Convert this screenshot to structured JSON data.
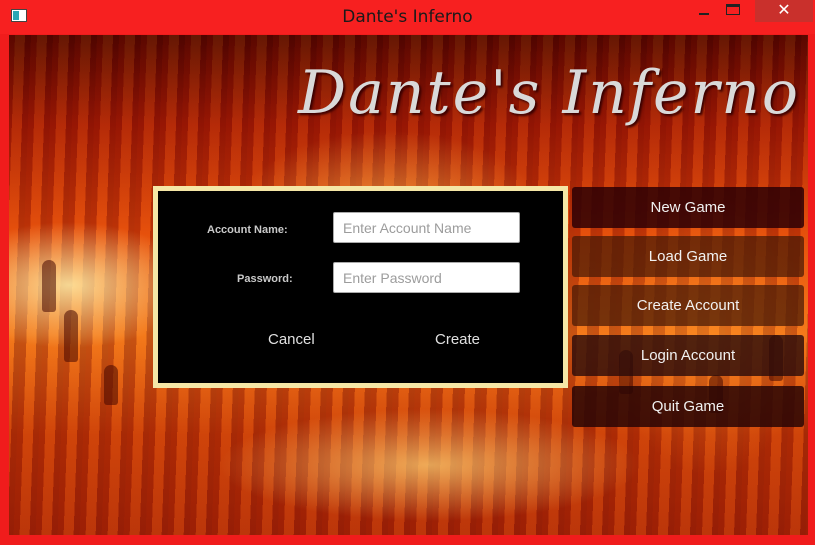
{
  "window": {
    "title": "Dante's Inferno",
    "minimize_label": "—",
    "maximize_label": "",
    "close_label": "✕"
  },
  "logo": {
    "text": "Dante's Inferno"
  },
  "dialog": {
    "account_label": "Account Name:",
    "account_placeholder": "Enter Account Name",
    "password_label": "Password:",
    "password_placeholder": "Enter Password",
    "cancel_label": "Cancel",
    "create_label": "Create"
  },
  "menu": {
    "new_game": "New Game",
    "load_game": "Load Game",
    "create_account": "Create Account",
    "login_account": "Login Account",
    "quit_game": "Quit Game"
  },
  "colors": {
    "window_frame": "#f01c1c",
    "dialog_border": "#f5e7a6",
    "dialog_background": "#000000"
  }
}
